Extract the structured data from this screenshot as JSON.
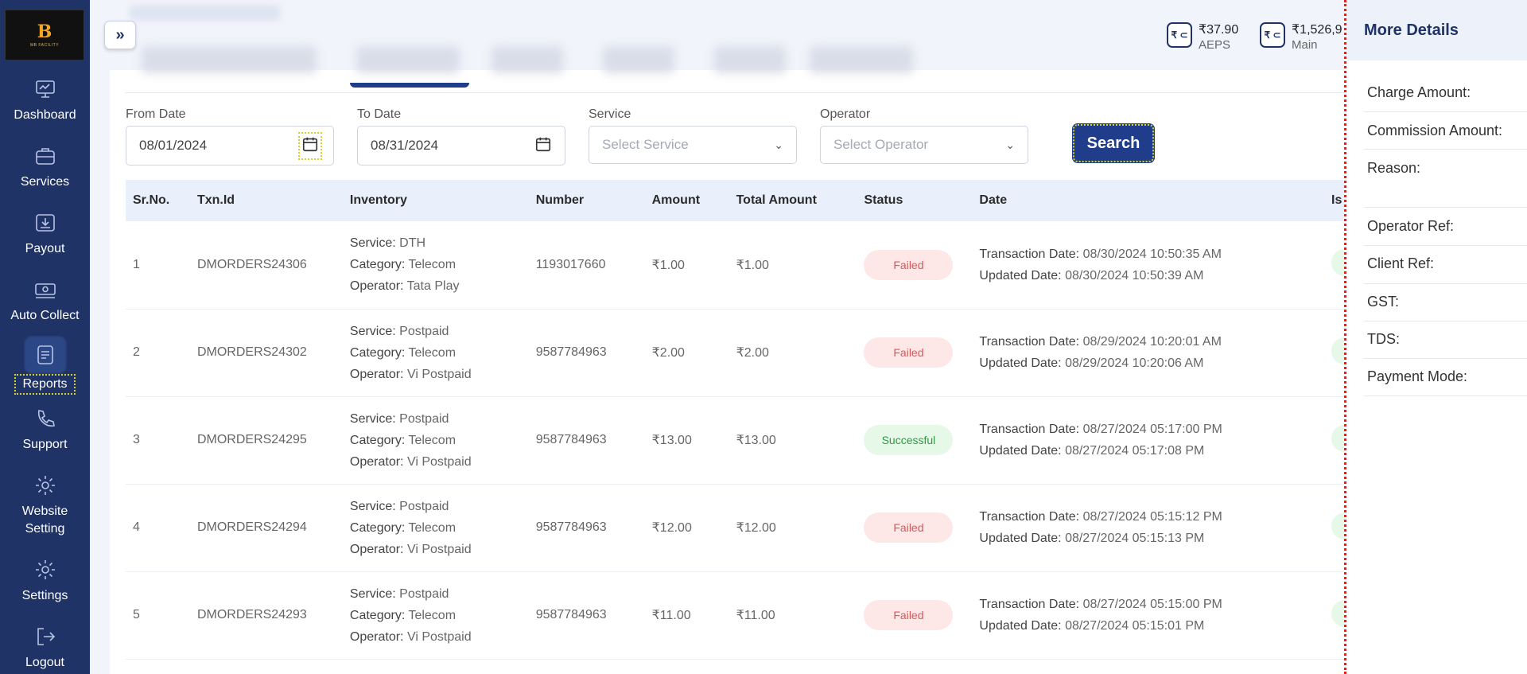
{
  "sidebar": {
    "logo_small_text": "MB FACILITY",
    "items": [
      {
        "label": "Dashboard",
        "icon": "dashboard-icon"
      },
      {
        "label": "Services",
        "icon": "briefcase-icon"
      },
      {
        "label": "Payout",
        "icon": "payout-icon"
      },
      {
        "label": "Auto Collect",
        "icon": "cash-icon"
      },
      {
        "label": "Reports",
        "icon": "report-icon"
      },
      {
        "label": "Support",
        "icon": "phone-icon"
      },
      {
        "label": "Website Setting",
        "icon": "gear-icon"
      },
      {
        "label": "Settings",
        "icon": "gear-icon"
      },
      {
        "label": "Logout",
        "icon": "logout-icon"
      }
    ]
  },
  "header": {
    "toggle_symbol": "»",
    "wallets": [
      {
        "icon_text": "₹ ⊂",
        "amount": "₹37.90",
        "label": "AEPS"
      },
      {
        "icon_text": "₹ ⊂",
        "amount": "₹1,526,9",
        "label": "Main"
      }
    ]
  },
  "filters": {
    "from_date": {
      "label": "From Date",
      "value": "08/01/2024"
    },
    "to_date": {
      "label": "To Date",
      "value": "08/31/2024"
    },
    "service": {
      "label": "Service",
      "placeholder": "Select Service"
    },
    "operator": {
      "label": "Operator",
      "placeholder": "Select Operator"
    },
    "search_label": "Search"
  },
  "table": {
    "columns": [
      "Sr.No.",
      "Txn.Id",
      "Inventory",
      "Number",
      "Amount",
      "Total Amount",
      "Status",
      "Date",
      "Is"
    ],
    "inventory_keys": {
      "service": "Service:",
      "category": "Category:",
      "operator": "Operator:"
    },
    "date_keys": {
      "txn": "Transaction Date:",
      "updated": "Updated Date:"
    },
    "rows": [
      {
        "sr": "1",
        "txn": "DMORDERS24306",
        "service": "DTH",
        "category": "Telecom",
        "operator": "Tata Play",
        "number": "1193017660",
        "amount": "₹1.00",
        "total": "₹1.00",
        "status": "Failed",
        "txn_date": "08/30/2024 10:50:35 AM",
        "updated_date": "08/30/2024 10:50:39 AM"
      },
      {
        "sr": "2",
        "txn": "DMORDERS24302",
        "service": "Postpaid",
        "category": "Telecom",
        "operator": "Vi Postpaid",
        "number": "9587784963",
        "amount": "₹2.00",
        "total": "₹2.00",
        "status": "Failed",
        "txn_date": "08/29/2024 10:20:01 AM",
        "updated_date": "08/29/2024 10:20:06 AM"
      },
      {
        "sr": "3",
        "txn": "DMORDERS24295",
        "service": "Postpaid",
        "category": "Telecom",
        "operator": "Vi Postpaid",
        "number": "9587784963",
        "amount": "₹13.00",
        "total": "₹13.00",
        "status": "Successful",
        "txn_date": "08/27/2024 05:17:00 PM",
        "updated_date": "08/27/2024 05:17:08 PM"
      },
      {
        "sr": "4",
        "txn": "DMORDERS24294",
        "service": "Postpaid",
        "category": "Telecom",
        "operator": "Vi Postpaid",
        "number": "9587784963",
        "amount": "₹12.00",
        "total": "₹12.00",
        "status": "Failed",
        "txn_date": "08/27/2024 05:15:12 PM",
        "updated_date": "08/27/2024 05:15:13 PM"
      },
      {
        "sr": "5",
        "txn": "DMORDERS24293",
        "service": "Postpaid",
        "category": "Telecom",
        "operator": "Vi Postpaid",
        "number": "9587784963",
        "amount": "₹11.00",
        "total": "₹11.00",
        "status": "Failed",
        "txn_date": "08/27/2024 05:15:00 PM",
        "updated_date": "08/27/2024 05:15:01 PM"
      }
    ]
  },
  "panel": {
    "title": "More Details",
    "fields": [
      "Charge Amount:",
      "Commission Amount:",
      "Reason:",
      "Operator Ref:",
      "Client Ref:",
      "GST:",
      "TDS:",
      "Payment Mode:"
    ]
  },
  "colors": {
    "sidebar": "#1f3366",
    "accent": "#1f3d8a",
    "failed": "#e25555",
    "success": "#2d9c43"
  }
}
